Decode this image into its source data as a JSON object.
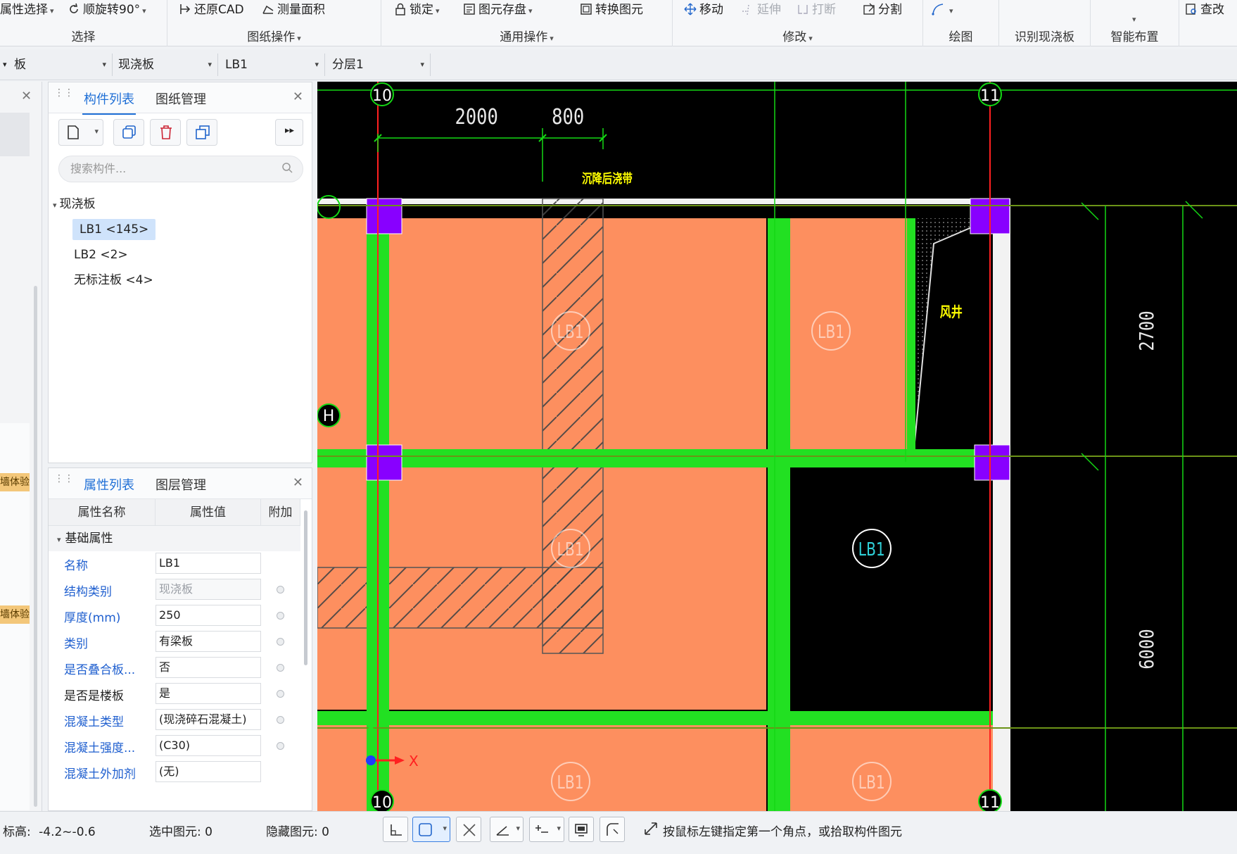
{
  "ribbon": {
    "groups": [
      {
        "label": "选择",
        "buttons": [
          {
            "label": "属性选择"
          },
          {
            "label": "顺旋转90°"
          }
        ]
      },
      {
        "label": "图纸操作",
        "buttons": [
          {
            "label": "还原CAD"
          },
          {
            "label": "测量面积"
          }
        ]
      },
      {
        "label": "通用操作",
        "buttons": [
          {
            "label": "锁定"
          },
          {
            "label": "图元存盘"
          },
          {
            "label": "转换图元"
          }
        ]
      },
      {
        "label": "修改",
        "buttons": [
          {
            "label": "移动"
          },
          {
            "label": "延伸"
          },
          {
            "label": "打断"
          },
          {
            "label": "分割"
          }
        ]
      },
      {
        "label": "绘图"
      },
      {
        "label": "识别现浇板"
      },
      {
        "label": "智能布置"
      },
      {
        "label": "",
        "buttons": [
          {
            "label": "查改"
          }
        ]
      }
    ]
  },
  "selectors": [
    {
      "value": "板"
    },
    {
      "value": "现浇板"
    },
    {
      "value": "LB1"
    },
    {
      "value": "分层1"
    }
  ],
  "left_strip": {
    "tags": [
      "墙体验",
      "墙体验"
    ]
  },
  "component_panel": {
    "tabs": [
      "构件列表",
      "图纸管理"
    ],
    "search_placeholder": "搜索构件...",
    "tree": {
      "root": "现浇板",
      "items": [
        "LB1 <145>",
        "LB2 <2>",
        "无标注板 <4>"
      ]
    }
  },
  "property_panel": {
    "tabs": [
      "属性列表",
      "图层管理"
    ],
    "headers": [
      "属性名称",
      "属性值",
      "附加"
    ],
    "category": "基础属性",
    "rows": [
      {
        "name": "名称",
        "value": "LB1"
      },
      {
        "name": "结构类别",
        "value": "现浇板"
      },
      {
        "name": "厚度(mm)",
        "value": "250"
      },
      {
        "name": "类别",
        "value": "有梁板"
      },
      {
        "name": "是否叠合板...",
        "value": "否"
      },
      {
        "name": "是否是楼板",
        "value": "是"
      },
      {
        "name": "混凝土类型",
        "value": "(现浇碎石混凝土)"
      },
      {
        "name": "混凝土强度...",
        "value": "(C30)"
      },
      {
        "name": "混凝土外加剂",
        "value": "(无)"
      }
    ]
  },
  "canvas": {
    "axis_labels": {
      "top_left": "10",
      "top_right": "11",
      "bottom_left": "10",
      "bottom_right": "11",
      "row_h": "H"
    },
    "dimensions": {
      "dim1": "2000",
      "dim2": "800",
      "right_upper": "2700",
      "right_lower": "6000"
    },
    "annotations": {
      "post_pour": "沉降后浇带",
      "shaft": "风井"
    },
    "slab_label": "LB1",
    "axis_x_label": "X",
    "colors": {
      "slab": "#fd8f5f",
      "beam": "#22e022",
      "column": "#8800ff",
      "axis_red": "#ff2020",
      "axis_green": "#14d814",
      "bg": "#000000"
    }
  },
  "status": {
    "elevation_label": "标高:",
    "elevation": "-4.2~-0.6",
    "selected_label": "选中图元:",
    "selected": "0",
    "hidden_label": "隐藏图元:",
    "hidden": "0",
    "hint": "按鼠标左键指定第一个角点，或拾取构件图元"
  }
}
